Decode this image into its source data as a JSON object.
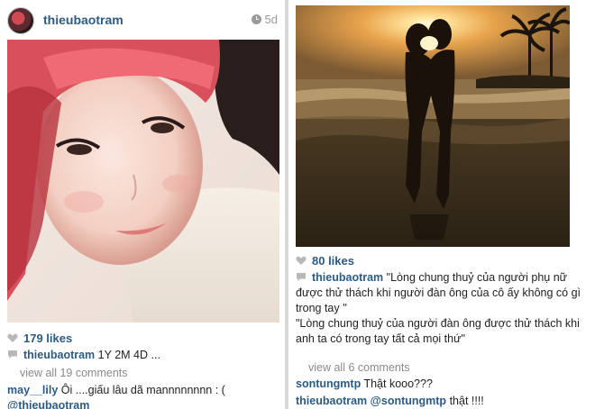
{
  "left_post": {
    "username": "thieubaotram",
    "time": "5d",
    "likes": "179 likes",
    "caption_user": "thieubaotram",
    "caption_text": "1Y 2M 4D ...",
    "view_all": "view all 19 comments",
    "comments": [
      {
        "user": "may__lily",
        "text": "Ôi ....giấu lâu dã mannnnnnnn : (",
        "mention": "@thieubaotram"
      }
    ]
  },
  "right_post": {
    "likes": "80 likes",
    "caption_user": "thieubaotram",
    "caption_text_1": "\"Lòng chung thuỷ của người phụ nữ được thử thách khi người đàn ông của cô ấy không có gì trong tay ''",
    "caption_text_2": "\"Lòng chung thuỷ của người đàn ông được thử thách khi anh ta có trong tay tất cả mọi thứ\"",
    "view_all": "view all 6 comments",
    "comments": [
      {
        "user": "sontungmtp",
        "text": "Thật kooo???"
      },
      {
        "user": "thieubaotram",
        "mention": "@sontungmtp",
        "text": "thật !!!!"
      }
    ]
  },
  "colors": {
    "username_blue": "#2c5b86",
    "meta_gray": "#8a8a8a"
  },
  "icons": {
    "time": "clock-icon",
    "likes": "heart-icon",
    "comments": "comment-bubble-icon"
  }
}
